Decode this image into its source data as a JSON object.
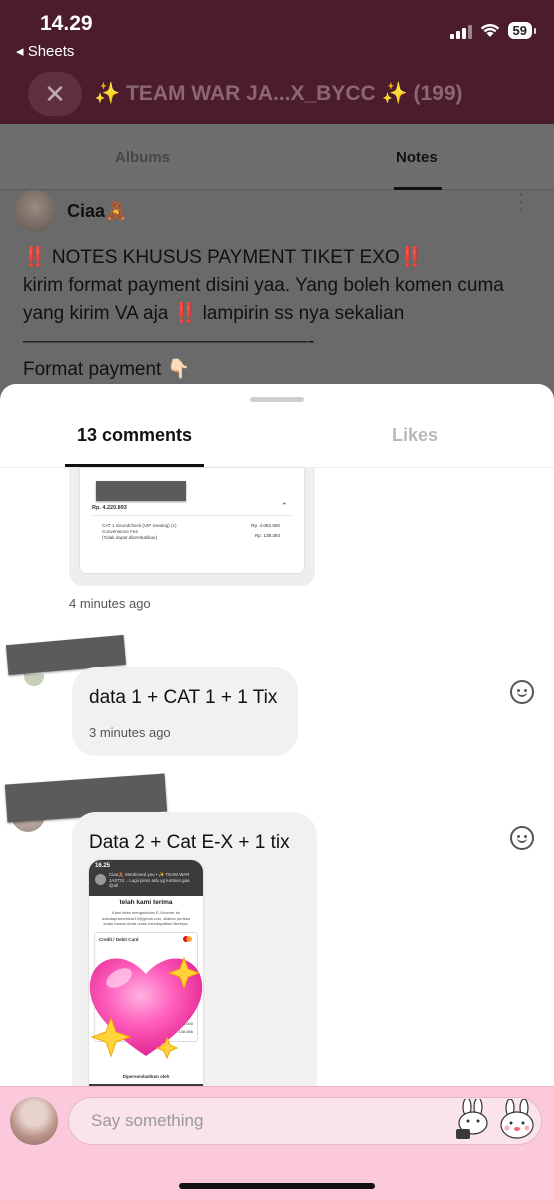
{
  "status_bar": {
    "time": "14.29",
    "back_label": "◂ Sheets",
    "battery": "59"
  },
  "header": {
    "close_icon": "close-icon",
    "title": "✨ TEAM WAR JA...X_BYCC ✨ (199)"
  },
  "bg_tabs": {
    "albums": "Albums",
    "notes": "Notes"
  },
  "post": {
    "author": "Ciaa🧸",
    "text": "‼️ NOTES KHUSUS PAYMENT TIKET EXO‼️\nkirim format payment disini yaa. Yang boleh komen cuma yang kirim VA aja ‼️ lampirin ss nya sekalian\n———————————————-\nFormat payment 👇🏻\n(NO DATA – SECTION TIKET – JUMLAH – VIRTUAL"
  },
  "sheet": {
    "tabs": {
      "comments": "13 comments",
      "likes": "Likes"
    }
  },
  "comments": [
    {
      "time": "4 minutes ago",
      "attachment": {
        "amount": "Rp. 4.220.893",
        "item": "CAT 1 Soundcheck (VIP Seating) (1)",
        "fee": "Convenience Fee",
        "note": "(Tidak dapat dikembalikan)",
        "price_item": "Rp. 4.082.500",
        "price_fee": "Rp. 138.393"
      }
    },
    {
      "text": "data 1 + CAT 1 + 1 Tix",
      "time": "3 minutes ago"
    },
    {
      "text": "Data 2 + Cat E-X + 1 tix",
      "attachment": {
        "time": "16.25",
        "notif": "Ciaa🧸 Mentioned you • ✨ TEAM WAR JASTIX... Lagii pisss adu yg lumbus gaa @all",
        "title": "telah kami terima",
        "body": "Kami telah mengirimkan E-Voucher ke adindapramestear13@gmail.com, silakan periksa kotak masuk Anda untuk mendapatkan tiketnya.",
        "card_title": "Credit / Debit Card",
        "price1": "Rp. 125.000",
        "price2": "Rp. 138.666",
        "footer": "Dipersembahkan oleh"
      }
    }
  ],
  "composer": {
    "placeholder": "Say something"
  },
  "colors": {
    "header_bg": "#4b1c2c",
    "composer_bg": "#fbc8dc",
    "sheet_bg": "#ffffff",
    "bubble_bg": "#f1f1f1"
  }
}
